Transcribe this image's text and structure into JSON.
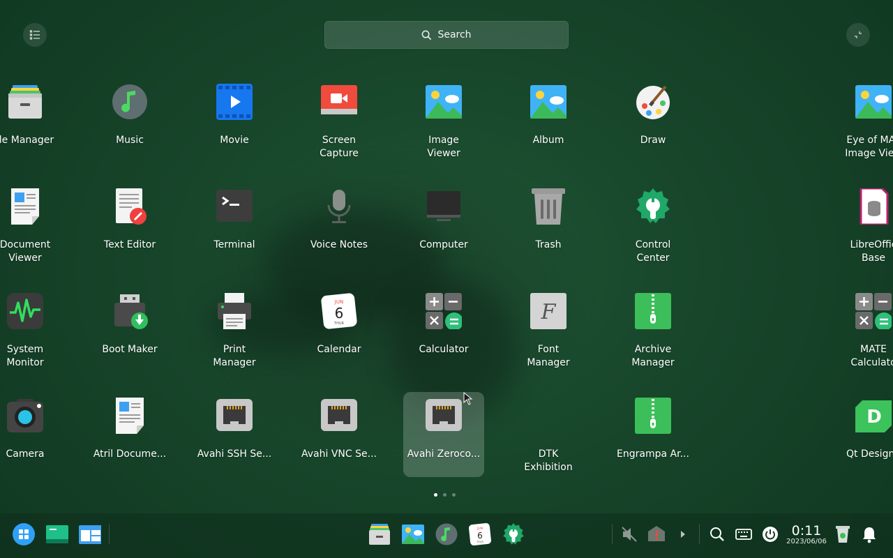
{
  "search": {
    "label": "Search"
  },
  "apps": [
    {
      "label": "ile Manager",
      "icon": "file-manager-icon"
    },
    {
      "label": "Music",
      "icon": "music-icon"
    },
    {
      "label": "Movie",
      "icon": "movie-icon"
    },
    {
      "label": "Screen\nCapture",
      "icon": "screen-capture-icon"
    },
    {
      "label": "Image\nViewer",
      "icon": "image-viewer-icon"
    },
    {
      "label": "Album",
      "icon": "album-icon"
    },
    {
      "label": "Draw",
      "icon": "draw-icon"
    },
    {
      "label": "Eye of MAT\nImage View",
      "icon": "eye-of-mate-icon"
    },
    {
      "label": "Document\nViewer",
      "icon": "document-viewer-icon"
    },
    {
      "label": "Text Editor",
      "icon": "text-editor-icon"
    },
    {
      "label": "Terminal",
      "icon": "terminal-icon"
    },
    {
      "label": "Voice Notes",
      "icon": "voice-notes-icon"
    },
    {
      "label": "Computer",
      "icon": "computer-icon"
    },
    {
      "label": "Trash",
      "icon": "trash-icon"
    },
    {
      "label": "Control\nCenter",
      "icon": "control-center-icon"
    },
    {
      "label": "LibreOffic\nBase",
      "icon": "libreoffice-base-icon"
    },
    {
      "label": "System\nMonitor",
      "icon": "system-monitor-icon"
    },
    {
      "label": "Boot Maker",
      "icon": "boot-maker-icon"
    },
    {
      "label": "Print\nManager",
      "icon": "print-manager-icon"
    },
    {
      "label": "Calendar",
      "icon": "calendar-icon"
    },
    {
      "label": "Calculator",
      "icon": "calculator-icon"
    },
    {
      "label": "Font\nManager",
      "icon": "font-manager-icon"
    },
    {
      "label": "Archive\nManager",
      "icon": "archive-manager-icon"
    },
    {
      "label": "MATE\nCalculato",
      "icon": "mate-calculator-icon"
    },
    {
      "label": "Camera",
      "icon": "camera-icon"
    },
    {
      "label": "Atril Docume...",
      "icon": "atril-document-icon"
    },
    {
      "label": "Avahi SSH Se...",
      "icon": "avahi-ssh-icon"
    },
    {
      "label": "Avahi VNC Se...",
      "icon": "avahi-vnc-icon"
    },
    {
      "label": "Avahi Zeroco...",
      "icon": "avahi-zeroconf-icon"
    },
    {
      "label": "DTK\nExhibition",
      "icon": "dtk-exhibition-icon"
    },
    {
      "label": "Engrampa Ar...",
      "icon": "engrampa-icon"
    },
    {
      "label": "Qt Designe",
      "icon": "qt-designer-icon"
    }
  ],
  "calendar_icon": {
    "month": "JUN",
    "day": "6",
    "weekday": "THUR"
  },
  "pager": {
    "pages": 3,
    "active": 1
  },
  "clock": {
    "time": "0:11",
    "date": "2023/06/06"
  },
  "colors": {
    "accent": "#2ea0f7",
    "green": "#23b85b",
    "background": "#1a4a2e"
  }
}
